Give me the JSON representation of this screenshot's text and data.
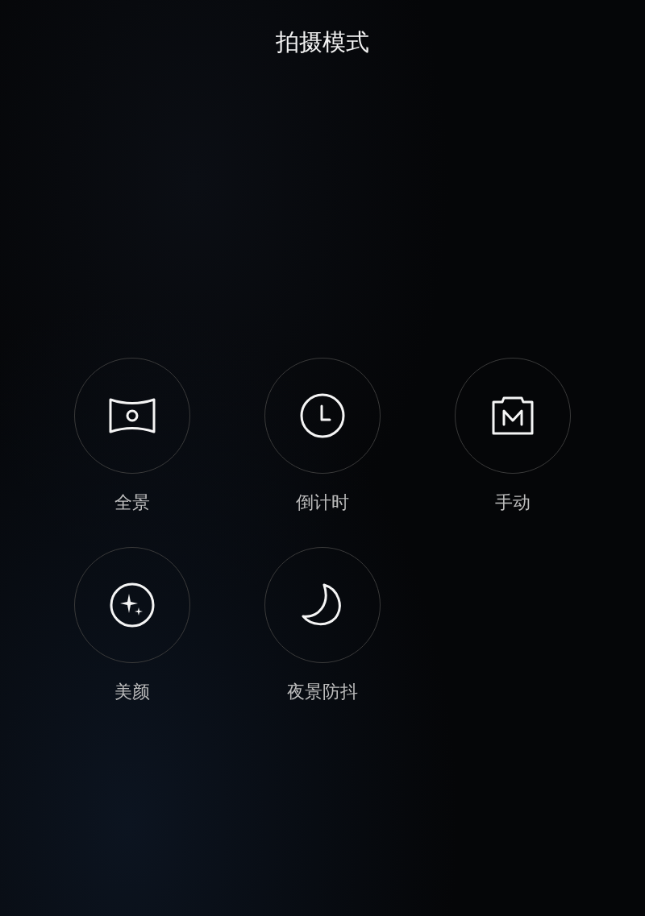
{
  "title": "拍摄模式",
  "modes": [
    {
      "kind": "panorama",
      "label": "全景"
    },
    {
      "kind": "timer",
      "label": "倒计时"
    },
    {
      "kind": "manual",
      "label": "手动"
    },
    {
      "kind": "beauty",
      "label": "美颜"
    },
    {
      "kind": "night",
      "label": "夜景防抖"
    }
  ]
}
